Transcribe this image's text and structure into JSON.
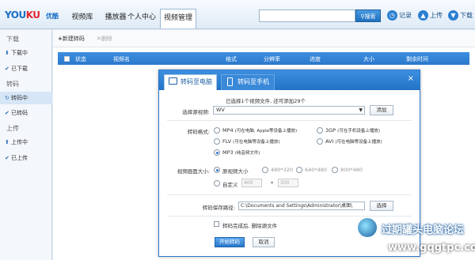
{
  "app": {
    "logo_main": "YOU",
    "logo_mid": "KU",
    "logo_sub": "优酷"
  },
  "nav": {
    "tabs": [
      {
        "label": "视频库"
      },
      {
        "label": "播放器"
      },
      {
        "label": "个人中心"
      },
      {
        "label": "视频管理"
      }
    ]
  },
  "search": {
    "value": "",
    "button_label": "搜索"
  },
  "top_actions": {
    "record": "记录",
    "upload": "上传",
    "download": "下载"
  },
  "sidebar": {
    "groups": [
      {
        "title": "下载",
        "items": [
          {
            "label": "下载中"
          },
          {
            "label": "已下载"
          }
        ]
      },
      {
        "title": "转码",
        "items": [
          {
            "label": "转码中"
          },
          {
            "label": "已转码"
          }
        ]
      },
      {
        "title": "上传",
        "items": [
          {
            "label": "上传中"
          },
          {
            "label": "已上传"
          }
        ]
      }
    ],
    "active_item": "转码中"
  },
  "toolbar": {
    "new_task": "新建转码",
    "delete": "删除"
  },
  "table": {
    "columns": [
      "状态",
      "视频名",
      "格式",
      "分辨率",
      "进度",
      "大小",
      "剩余时间"
    ]
  },
  "dialog": {
    "tab_pc": "转码至电脑",
    "tab_phone": "转码至手机",
    "close": "×",
    "selected_info": "已选择1个视频文件, 还可添加29个",
    "select_label": "选择源视频:",
    "select_value": "WV",
    "add_button": "添加",
    "format_label": "转码格式:",
    "formats": [
      {
        "name": "MP4",
        "note": "(可在电脑, Apple等设备上播放)"
      },
      {
        "name": "3GP",
        "note": "(可在手机设备上播放)"
      },
      {
        "name": "FLV",
        "note": "(可在电脑等设备上播放)"
      },
      {
        "name": "AVI",
        "note": "(可在电脑等设备上播放)"
      },
      {
        "name": "MP3",
        "note": "(纯音频文件)"
      }
    ],
    "selected_format": "MP3",
    "size_label": "视频画面大小:",
    "sizes": [
      "原视频大小",
      "480*320",
      "640*480",
      "800*480"
    ],
    "custom_label": "自定义",
    "custom_width": "400",
    "custom_height": "300",
    "custom_sep": "*",
    "path_label": "转码保存路径:",
    "path_value": "C:\\Documents and Settings\\Administrator\\桌面\\",
    "browse_button": "选择",
    "delete_source_label": "转码完成后, 删除源文件",
    "start_button": "开始转码",
    "cancel_button": "取消"
  },
  "watermark": {
    "text": "过期罐头电脑论坛",
    "url": "www.gqgtpc.com"
  }
}
